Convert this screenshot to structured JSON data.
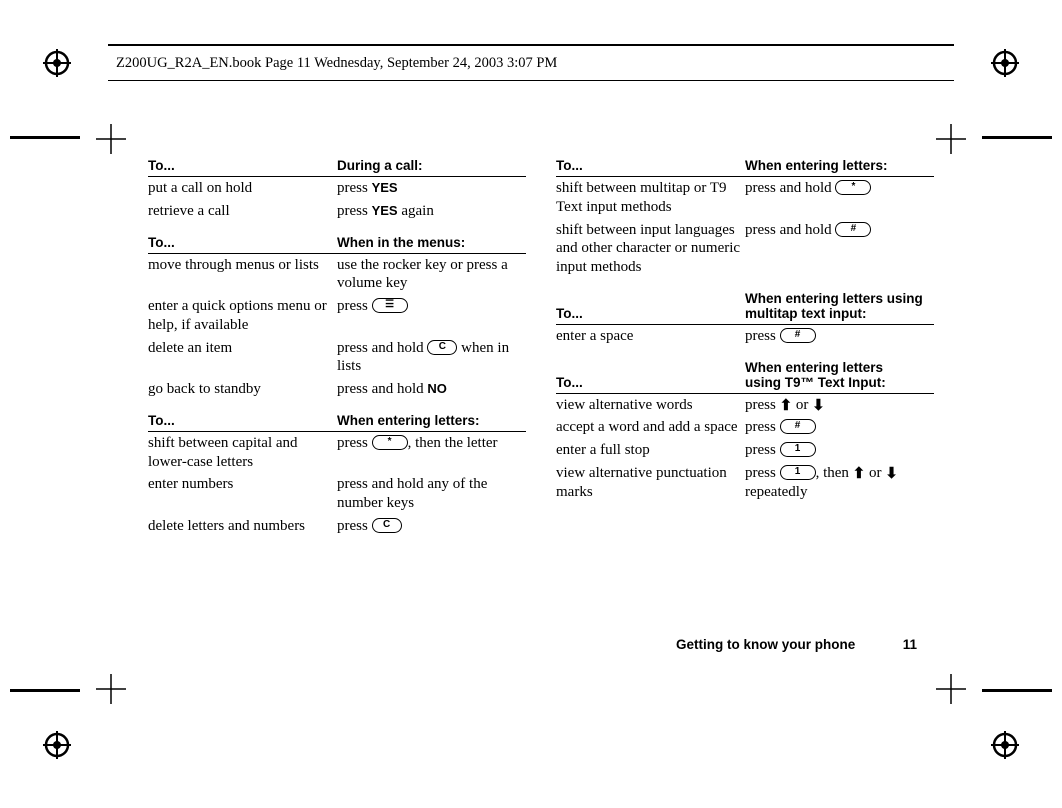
{
  "header": {
    "text": "Z200UG_R2A_EN.book  Page 11  Wednesday, September 24, 2003  3:07 PM"
  },
  "footer": {
    "section": "Getting to know your phone",
    "page": "11"
  },
  "left": {
    "sec1": {
      "h1": "To...",
      "h2": "During a call:",
      "rows": [
        {
          "c1": "put a call on hold",
          "prefix": "press ",
          "sc": "YES",
          "suffix": ""
        },
        {
          "c1": "retrieve a call",
          "prefix": "press ",
          "sc": "YES",
          "suffix": " again"
        }
      ]
    },
    "sec2": {
      "h1": "To...",
      "h2": "When in the menus:",
      "r0_c1": "move through menus or lists",
      "r0_c2": "use the rocker key or press a volume key",
      "r1_c1": "enter a quick options menu or help, if available",
      "r1_pre": "press ",
      "r1_key": "☰",
      "r2_c1": "delete an item",
      "r2_pre": "press and hold ",
      "r2_key": "C",
      "r2_suf": " when in lists",
      "r3_c1": "go back to standby",
      "r3_pre": "press and hold ",
      "r3_sc": "NO"
    },
    "sec3": {
      "h1": "To...",
      "h2": "When entering letters:",
      "r0_c1": "shift between capital and lower-case letters",
      "r0_pre": "press ",
      "r0_key": "*",
      "r0_suf": ", then the letter",
      "r1_c1": "enter numbers",
      "r1_c2": "press and hold any of the number keys",
      "r2_c1": "delete letters and numbers",
      "r2_pre": "press ",
      "r2_key": "C"
    }
  },
  "right": {
    "sec1": {
      "h1": "To...",
      "h2": "When entering letters:",
      "r0_c1": "shift between multitap or T9 Text input methods",
      "r0_pre": "press and hold ",
      "r0_key": "*",
      "r1_c1": "shift between input languages and other character or numeric input methods",
      "r1_pre": "press and hold ",
      "r1_key": "#"
    },
    "sec2": {
      "h1": "To...",
      "h2": "When entering letters using multitap text input:",
      "r0_c1": "enter a space",
      "r0_pre": "press ",
      "r0_key": "#"
    },
    "sec3": {
      "h1": "To...",
      "h2_l1": "When entering letters",
      "h2_l2": "using T9™ Text Input:",
      "r0_c1": "view alternative words",
      "r0_pre": "press ",
      "r0_mid": " or ",
      "r1_c1": "accept a word and add a space",
      "r1_pre": "press ",
      "r1_key": "#",
      "r2_c1": "enter a full stop",
      "r2_pre": "press ",
      "r2_key": "1",
      "r3_c1": "view alternative punctuation marks",
      "r3_pre": "press ",
      "r3_key": "1",
      "r3_mid1": ", then ",
      "r3_mid2": " or ",
      "r3_suf": " repeatedly"
    }
  }
}
